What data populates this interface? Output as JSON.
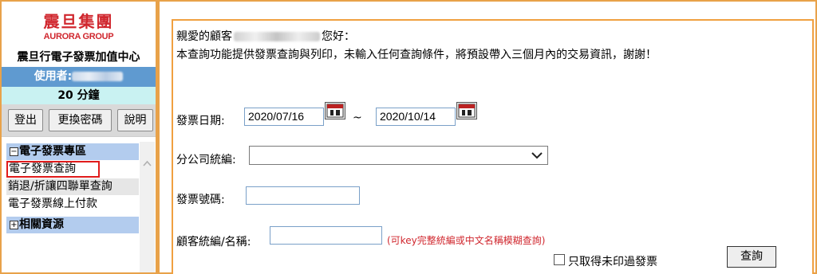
{
  "sidebar": {
    "logo_cn": "震旦集團",
    "logo_en": "AURORA GROUP",
    "center_name": "震旦行電子發票加值中心",
    "user_label": "使用者:",
    "timer": "20 分鐘",
    "buttons": {
      "logout": "登出",
      "change_password": "更換密碼",
      "help": "說明"
    },
    "sections": [
      {
        "toggle": "−",
        "title": "電子發票專區",
        "items": [
          "電子發票查詢",
          "銷退/折讓四聯單查詢",
          "電子發票線上付款"
        ]
      },
      {
        "toggle": "+",
        "title": "相關資源",
        "items": []
      }
    ],
    "active_item": "電子發票查詢"
  },
  "main": {
    "greeting_prefix": "親愛的顧客",
    "greeting_suffix": "您好：",
    "intro": "本查詢功能提供發票查詢與列印，未輸入任何查詢條件，將預設帶入三個月內的交易資訊，謝謝！",
    "form": {
      "date_label": "發票日期:",
      "date_start": "2020/07/16",
      "date_sep": "~",
      "date_end": "2020/10/14",
      "branch_label": "分公司統編:",
      "branch_value": "",
      "invoice_no_label": "發票號碼:",
      "invoice_no_value": "",
      "customer_label": "顧客統編/名稱:",
      "customer_value": "",
      "customer_hint": "(可key完整統編或中文名稱模糊查詢)",
      "unprinted_only_label": "只取得未印過發票",
      "unprinted_only_checked": false,
      "query_button": "查詢"
    }
  },
  "colors": {
    "frame_border": "#e8a24a",
    "brand_red": "#d0272e",
    "user_bar": "#5f9ad0",
    "timer_bar": "#c9f2f2",
    "section_head": "#b3ccee",
    "active_outline": "#e01b1b"
  },
  "icons": [
    "calendar-icon",
    "chevron-down-icon",
    "scroll-up-arrow-icon"
  ]
}
